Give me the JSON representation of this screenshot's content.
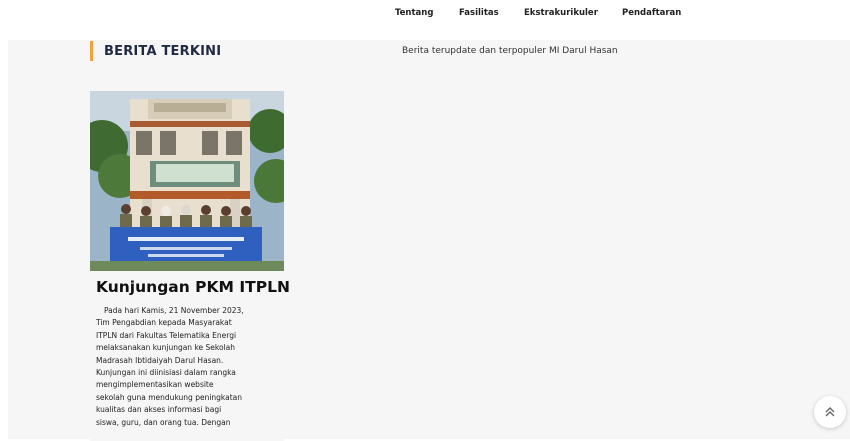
{
  "nav": {
    "items": [
      {
        "label": "Tentang"
      },
      {
        "label": "Fasilitas"
      },
      {
        "label": "Ekstrakurikuler"
      },
      {
        "label": "Pendaftaran"
      }
    ]
  },
  "section": {
    "title": "BERITA TERKINI",
    "subtitle": "Berita terupdate dan terpopuler MI Darul Hasan"
  },
  "news": [
    {
      "title": "Kunjungan PKM ITPLN",
      "body_lines": [
        "Pada hari Kamis, 21 November 2023,",
        "Tim Pengabdian kepada Masyarakat",
        "ITPLN dari Fakultas Telematika Energi",
        "melaksanakan kunjungan ke Sekolah",
        "Madrasah Ibtidaiyah Darul Hasan.",
        "Kunjungan ini diinisiasi dalam rangka",
        "mengimplementasikan website",
        "sekolah guna mendukung peningkatan",
        "kualitas dan akses informasi bagi",
        "siswa, guru, dan orang tua. Dengan"
      ]
    }
  ],
  "colors": {
    "accent": "#f2a23c",
    "content_bg": "#f6f6f6",
    "title": "#1f2a44",
    "banner": "#2f5fbf"
  },
  "icons": {
    "scroll_top": "chevron-double-up-icon"
  }
}
